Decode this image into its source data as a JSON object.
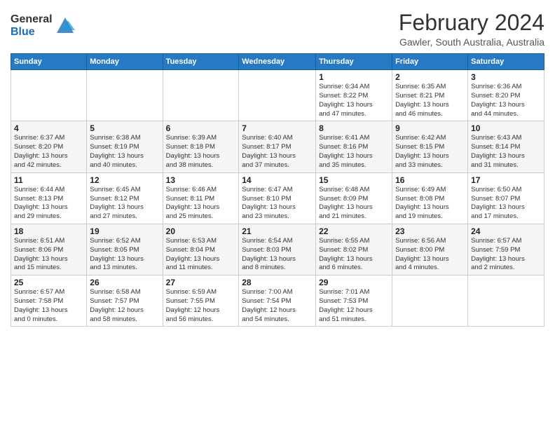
{
  "logo": {
    "general": "General",
    "blue": "Blue"
  },
  "title": "February 2024",
  "subtitle": "Gawler, South Australia, Australia",
  "weekdays": [
    "Sunday",
    "Monday",
    "Tuesday",
    "Wednesday",
    "Thursday",
    "Friday",
    "Saturday"
  ],
  "weeks": [
    [
      {
        "day": "",
        "info": ""
      },
      {
        "day": "",
        "info": ""
      },
      {
        "day": "",
        "info": ""
      },
      {
        "day": "",
        "info": ""
      },
      {
        "day": "1",
        "info": "Sunrise: 6:34 AM\nSunset: 8:22 PM\nDaylight: 13 hours\nand 47 minutes."
      },
      {
        "day": "2",
        "info": "Sunrise: 6:35 AM\nSunset: 8:21 PM\nDaylight: 13 hours\nand 46 minutes."
      },
      {
        "day": "3",
        "info": "Sunrise: 6:36 AM\nSunset: 8:20 PM\nDaylight: 13 hours\nand 44 minutes."
      }
    ],
    [
      {
        "day": "4",
        "info": "Sunrise: 6:37 AM\nSunset: 8:20 PM\nDaylight: 13 hours\nand 42 minutes."
      },
      {
        "day": "5",
        "info": "Sunrise: 6:38 AM\nSunset: 8:19 PM\nDaylight: 13 hours\nand 40 minutes."
      },
      {
        "day": "6",
        "info": "Sunrise: 6:39 AM\nSunset: 8:18 PM\nDaylight: 13 hours\nand 38 minutes."
      },
      {
        "day": "7",
        "info": "Sunrise: 6:40 AM\nSunset: 8:17 PM\nDaylight: 13 hours\nand 37 minutes."
      },
      {
        "day": "8",
        "info": "Sunrise: 6:41 AM\nSunset: 8:16 PM\nDaylight: 13 hours\nand 35 minutes."
      },
      {
        "day": "9",
        "info": "Sunrise: 6:42 AM\nSunset: 8:15 PM\nDaylight: 13 hours\nand 33 minutes."
      },
      {
        "day": "10",
        "info": "Sunrise: 6:43 AM\nSunset: 8:14 PM\nDaylight: 13 hours\nand 31 minutes."
      }
    ],
    [
      {
        "day": "11",
        "info": "Sunrise: 6:44 AM\nSunset: 8:13 PM\nDaylight: 13 hours\nand 29 minutes."
      },
      {
        "day": "12",
        "info": "Sunrise: 6:45 AM\nSunset: 8:12 PM\nDaylight: 13 hours\nand 27 minutes."
      },
      {
        "day": "13",
        "info": "Sunrise: 6:46 AM\nSunset: 8:11 PM\nDaylight: 13 hours\nand 25 minutes."
      },
      {
        "day": "14",
        "info": "Sunrise: 6:47 AM\nSunset: 8:10 PM\nDaylight: 13 hours\nand 23 minutes."
      },
      {
        "day": "15",
        "info": "Sunrise: 6:48 AM\nSunset: 8:09 PM\nDaylight: 13 hours\nand 21 minutes."
      },
      {
        "day": "16",
        "info": "Sunrise: 6:49 AM\nSunset: 8:08 PM\nDaylight: 13 hours\nand 19 minutes."
      },
      {
        "day": "17",
        "info": "Sunrise: 6:50 AM\nSunset: 8:07 PM\nDaylight: 13 hours\nand 17 minutes."
      }
    ],
    [
      {
        "day": "18",
        "info": "Sunrise: 6:51 AM\nSunset: 8:06 PM\nDaylight: 13 hours\nand 15 minutes."
      },
      {
        "day": "19",
        "info": "Sunrise: 6:52 AM\nSunset: 8:05 PM\nDaylight: 13 hours\nand 13 minutes."
      },
      {
        "day": "20",
        "info": "Sunrise: 6:53 AM\nSunset: 8:04 PM\nDaylight: 13 hours\nand 11 minutes."
      },
      {
        "day": "21",
        "info": "Sunrise: 6:54 AM\nSunset: 8:03 PM\nDaylight: 13 hours\nand 8 minutes."
      },
      {
        "day": "22",
        "info": "Sunrise: 6:55 AM\nSunset: 8:02 PM\nDaylight: 13 hours\nand 6 minutes."
      },
      {
        "day": "23",
        "info": "Sunrise: 6:56 AM\nSunset: 8:00 PM\nDaylight: 13 hours\nand 4 minutes."
      },
      {
        "day": "24",
        "info": "Sunrise: 6:57 AM\nSunset: 7:59 PM\nDaylight: 13 hours\nand 2 minutes."
      }
    ],
    [
      {
        "day": "25",
        "info": "Sunrise: 6:57 AM\nSunset: 7:58 PM\nDaylight: 13 hours\nand 0 minutes."
      },
      {
        "day": "26",
        "info": "Sunrise: 6:58 AM\nSunset: 7:57 PM\nDaylight: 12 hours\nand 58 minutes."
      },
      {
        "day": "27",
        "info": "Sunrise: 6:59 AM\nSunset: 7:55 PM\nDaylight: 12 hours\nand 56 minutes."
      },
      {
        "day": "28",
        "info": "Sunrise: 7:00 AM\nSunset: 7:54 PM\nDaylight: 12 hours\nand 54 minutes."
      },
      {
        "day": "29",
        "info": "Sunrise: 7:01 AM\nSunset: 7:53 PM\nDaylight: 12 hours\nand 51 minutes."
      },
      {
        "day": "",
        "info": ""
      },
      {
        "day": "",
        "info": ""
      }
    ]
  ]
}
